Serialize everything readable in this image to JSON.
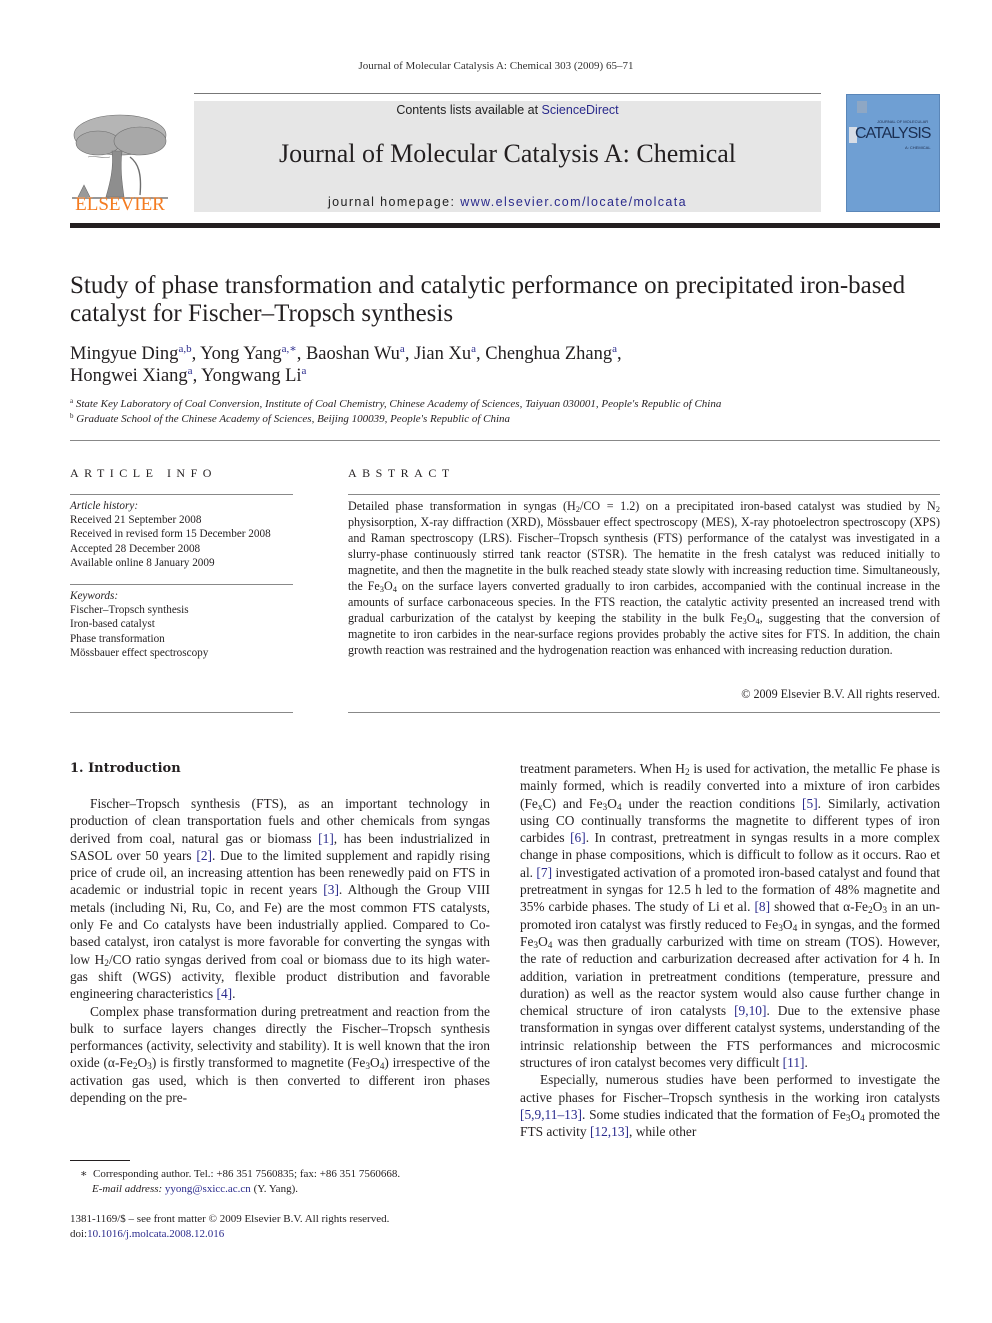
{
  "running_head": "Journal of Molecular Catalysis A: Chemical 303 (2009) 65–71",
  "masthead": {
    "contents_prefix": "Contents lists available at ",
    "contents_link": "ScienceDirect",
    "journal_name": "Journal of Molecular Catalysis A: Chemical",
    "homepage_prefix": "journal homepage: ",
    "homepage_link": "www.elsevier.com/locate/molcata",
    "publisher_logo_text": "ELSEVIER",
    "publisher_color": "#f47b20",
    "cover": {
      "top_text": "JOURNAL OF MOLECULAR",
      "title": "CATALYSIS",
      "subtitle": "A: CHEMICAL",
      "color": "#6f9fd3"
    }
  },
  "article": {
    "title": "Study of phase transformation and catalytic performance on precipitated iron-based catalyst for Fischer–Tropsch synthesis",
    "authors": [
      {
        "name": "Mingyue Ding",
        "sup": "a,b",
        "sep": ", "
      },
      {
        "name": "Yong Yang",
        "sup": "a,∗",
        "sep": ", "
      },
      {
        "name": "Baoshan Wu",
        "sup": "a",
        "sep": ", "
      },
      {
        "name": "Jian Xu",
        "sup": "a",
        "sep": ", "
      },
      {
        "name": "Chenghua Zhang",
        "sup": "a",
        "sep": ","
      },
      {
        "name": "Hongwei Xiang",
        "sup": "a",
        "sep": ", "
      },
      {
        "name": "Yongwang Li",
        "sup": "a",
        "sep": ""
      }
    ],
    "affiliations": [
      {
        "sup": "a",
        "text": "State Key Laboratory of Coal Conversion, Institute of Coal Chemistry, Chinese Academy of Sciences, Taiyuan 030001, People's Republic of China"
      },
      {
        "sup": "b",
        "text": "Graduate School of the Chinese Academy of Sciences, Beijing 100039, People's Republic of China"
      }
    ]
  },
  "article_info": {
    "heading": "ARTICLE INFO",
    "history_label": "Article history:",
    "history": [
      "Received 21 September 2008",
      "Received in revised form 15 December 2008",
      "Accepted 28 December 2008",
      "Available online 8 January 2009"
    ],
    "keywords_label": "Keywords:",
    "keywords": [
      "Fischer–Tropsch synthesis",
      "Iron-based catalyst",
      "Phase transformation",
      "Mössbauer effect spectroscopy"
    ]
  },
  "abstract": {
    "heading": "ABSTRACT",
    "segments": [
      "Detailed phase transformation in syngas (H",
      "2",
      "/CO = 1.2) on a precipitated iron-based catalyst was studied by N",
      "2",
      " physisorption, X-ray diffraction (XRD), Mössbauer effect spectroscopy (MES), X-ray photoelectron spectroscopy (XPS) and Raman spectroscopy (LRS). Fischer–Tropsch synthesis (FTS) performance of the catalyst was investigated in a slurry-phase continuously stirred tank reactor (STSR). The hematite in the fresh catalyst was reduced initially to magnetite, and then the magnetite in the bulk reached steady state slowly with increasing reduction time. Simultaneously, the Fe",
      "3",
      "O",
      "4",
      " on the surface layers converted gradually to iron carbides, accompanied with the continual increase in the amounts of surface carbonaceous species. In the FTS reaction, the catalytic activity presented an increased trend with gradual carburization of the catalyst by keeping the stability in the bulk Fe",
      "3",
      "O",
      "4",
      ", suggesting that the conversion of magnetite to iron carbides in the near-surface regions provides probably the active sites for FTS. In addition, the chain growth reaction was restrained and the hydrogenation reaction was enhanced with increasing reduction duration."
    ],
    "copyright": "© 2009 Elsevier B.V. All rights reserved."
  },
  "introduction": {
    "heading": "1.  Introduction",
    "left_column": {
      "p1": [
        "Fischer–Tropsch synthesis (FTS), as an important technology in production of clean transportation fuels and other chemicals from syngas derived from coal, natural gas or biomass ",
        "[1]",
        ", has been industrialized in SASOL over 50 years ",
        "[2]",
        ". Due to the limited supplement and rapidly rising price of crude oil, an increasing attention has been renewedly paid on FTS in academic or industrial topic in recent years ",
        "[3]",
        ". Although the Group VIII metals (including Ni, Ru, Co, and Fe) are the most common FTS catalysts, only Fe and Co catalysts have been industrially applied. Compared to Co-based catalyst, iron catalyst is more favorable for converting the syngas with low H",
        "2",
        "/CO ratio syngas derived from coal or biomass due to its high water-gas shift (WGS) activity, flexible product distribution and favorable engineering characteristics ",
        "[4]",
        "."
      ],
      "p2": [
        "Complex phase transformation during pretreatment and reaction from the bulk to surface layers changes directly the Fischer–Tropsch synthesis performances (activity, selectivity and stability). It is well known that the iron oxide (α-Fe",
        "2",
        "O",
        "3",
        ") is firstly transformed to magnetite (Fe",
        "3",
        "O",
        "4",
        ") irrespective of the activation gas used, which is then converted to different iron phases depending on the pre-"
      ]
    },
    "right_column": {
      "p1": [
        "treatment parameters. When H",
        "2",
        " is used for activation, the metallic Fe phase is mainly formed, which is readily converted into a mixture of iron carbides (Fe",
        "x",
        "C) and Fe",
        "3",
        "O",
        "4",
        " under the reaction conditions ",
        "[5]",
        ". Similarly, activation using CO continually transforms the magnetite to different types of iron carbides ",
        "[6]",
        ". In contrast, pretreatment in syngas results in a more complex change in phase compositions, which is difficult to follow as it occurs. Rao et al. ",
        "[7]",
        " investigated activation of a promoted iron-based catalyst and found that pretreatment in syngas for 12.5 h led to the formation of 48% magnetite and 35% carbide phases. The study of Li et al. ",
        "[8]",
        " showed that α-Fe",
        "2",
        "O",
        "3",
        " in an un-promoted iron catalyst was firstly reduced to Fe",
        "3",
        "O",
        "4",
        " in syngas, and the formed Fe",
        "3",
        "O",
        "4",
        " was then gradually carburized with time on stream (TOS). However, the rate of reduction and carburization decreased after activation for 4 h. In addition, variation in pretreatment conditions (temperature, pressure and duration) as well as the reactor system would also cause further change in chemical structure of iron catalysts ",
        "[9,10]",
        ". Due to the extensive phase transformation in syngas over different catalyst systems, understanding of the intrinsic relationship between the FTS performances and microcosmic structures of iron catalyst becomes very difficult ",
        "[11]",
        "."
      ],
      "p2": [
        "Especially, numerous studies have been performed to investigate the active phases for Fischer–Tropsch synthesis in the working iron catalysts ",
        "[5,9,11–13]",
        ". Some studies indicated that the formation of Fe",
        "3",
        "O",
        "4",
        " promoted the FTS activity ",
        "[12,13]",
        ", while other"
      ]
    }
  },
  "footnote": {
    "marker": "∗",
    "corresponding": "Corresponding author. Tel.: +86 351 7560835; fax: +86 351 7560668.",
    "email_label": "E-mail address: ",
    "email": "yyong@sxicc.ac.cn",
    "email_suffix": " (Y. Yang)."
  },
  "front_matter": {
    "issn_line": "1381-1169/$ – see front matter © 2009 Elsevier B.V. All rights reserved.",
    "doi_prefix": "doi:",
    "doi": "10.1016/j.molcata.2008.12.016"
  }
}
